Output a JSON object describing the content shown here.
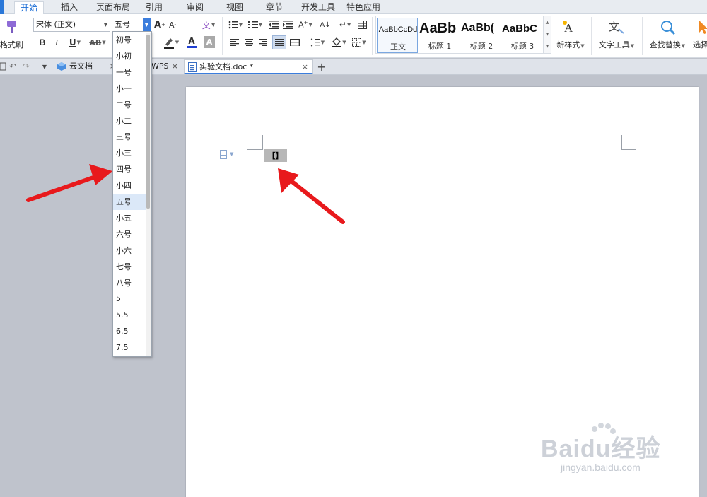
{
  "menu": {
    "tabs": [
      {
        "label": "开始",
        "active": true
      },
      {
        "label": "插入"
      },
      {
        "label": "页面布局"
      },
      {
        "label": "引用"
      },
      {
        "label": "审阅"
      },
      {
        "label": "视图"
      },
      {
        "label": "章节"
      },
      {
        "label": "开发工具"
      },
      {
        "label": "特色应用"
      }
    ]
  },
  "ribbon": {
    "format_painter_label": "格式刷",
    "font_name": "宋体 (正文)",
    "font_size": "五号",
    "bold_label": "B",
    "italic_label": "I",
    "underline_label": "U",
    "strike_label": "AB",
    "grow_font_label": "A",
    "shrink_font_label": "A",
    "font_color_label": "A",
    "char_shade_label": "A",
    "styles": [
      {
        "sample": "AaBbCcDd",
        "name": "正文"
      },
      {
        "sample": "AaBb",
        "name": "标题 1"
      },
      {
        "sample": "AaBb(",
        "name": "标题 2"
      },
      {
        "sample": "AaBbC",
        "name": "标题 3"
      }
    ],
    "new_style_label": "新样式",
    "text_tools_label": "文字工具",
    "find_replace_label": "查找替换",
    "select_label": "选择"
  },
  "tabs": {
    "cloud_label": "云文档",
    "wps_label": "WPS",
    "doc_label": "实验文档.doc *",
    "close_glyph": "×",
    "new_tab_glyph": "+"
  },
  "document": {
    "selected_text": "【】"
  },
  "font_size_dropdown": {
    "items": [
      "初号",
      "小初",
      "一号",
      "小一",
      "二号",
      "小二",
      "三号",
      "小三",
      "四号",
      "小四",
      "五号",
      "小五",
      "六号",
      "小六",
      "七号",
      "八号",
      "5",
      "5.5",
      "6.5",
      "7.5"
    ],
    "selected": "五号"
  },
  "watermark": {
    "logo": "Baidu经验",
    "url": "jingyan.baidu.com"
  },
  "colors": {
    "accent": "#3b7ddd",
    "arrow": "#e8191c",
    "font_color_bar": "#1f3fd1",
    "highlight_bar": "#222222"
  }
}
